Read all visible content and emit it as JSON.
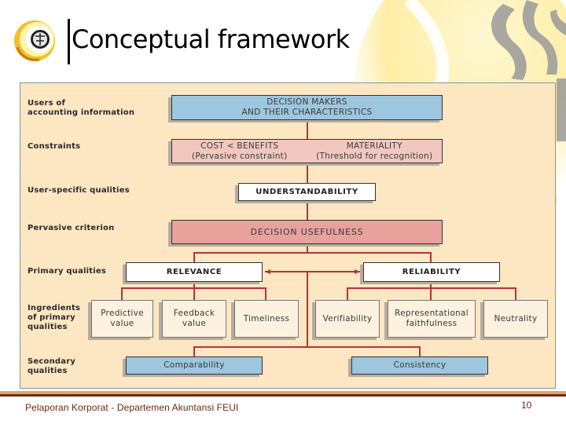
{
  "header": {
    "title": "Conceptual framework",
    "logo": "university-seal-logo"
  },
  "diagram": {
    "row_labels": {
      "users": "Users of\naccounting information",
      "constraints": "Constraints",
      "user_specific": "User-specific qualities",
      "pervasive": "Pervasive criterion",
      "primary": "Primary qualities",
      "ingredients": "Ingredients\nof primary\nqualities",
      "secondary": "Secondary\nqualities"
    },
    "boxes": {
      "decision_makers": "DECISION MAKERS\nAND THEIR CHARACTERISTICS",
      "cost_benefits": "COST < BENEFITS\n(Pervasive constraint)",
      "materiality": "MATERIALITY\n(Threshold for recognition)",
      "understandability": "UNDERSTANDABILITY",
      "decision_usefulness": "DECISION USEFULNESS",
      "relevance": "RELEVANCE",
      "reliability": "RELIABILITY",
      "predictive_value": "Predictive\nvalue",
      "feedback_value": "Feedback\nvalue",
      "timeliness": "Timeliness",
      "verifiability": "Verifiability",
      "representational_faithfulness": "Representational\nfaithfulness",
      "neutrality": "Neutrality",
      "comparability": "Comparability",
      "consistency": "Consistency"
    },
    "colors": {
      "panel_bg": "#fde6c2",
      "blue_box": "#9dc6df",
      "pink_box": "#f1c7c0",
      "rose_box": "#e8a29c",
      "connector": "#b5323a"
    }
  },
  "footer": {
    "text": "Pelaporan Korporat - Departemen Akuntansi FEUI",
    "page_number": "10"
  }
}
